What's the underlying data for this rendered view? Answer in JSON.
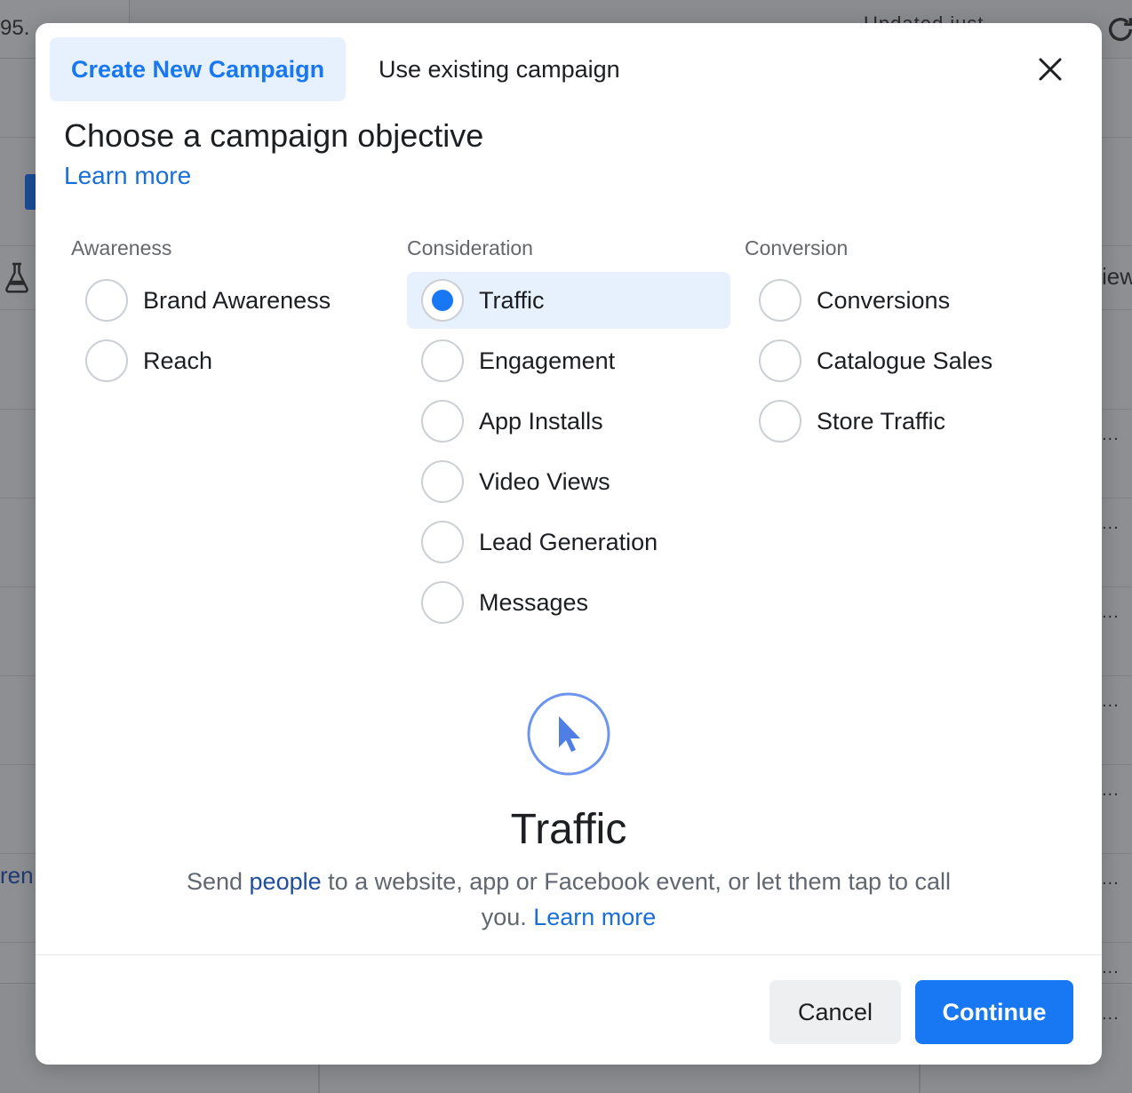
{
  "background": {
    "account_id_fragment": "95.",
    "updated_fragment": "Updated just",
    "view_fragment": "iew",
    "link_fragment": "ren",
    "row_dots": [
      "...",
      "...",
      "...",
      "...",
      "...",
      "...",
      "...",
      "..."
    ]
  },
  "modal": {
    "tabs": [
      {
        "label": "Create New Campaign",
        "active": true
      },
      {
        "label": "Use existing campaign",
        "active": false
      }
    ],
    "title": "Choose a campaign objective",
    "learn_more": "Learn more",
    "columns": [
      {
        "heading": "Awareness",
        "options": [
          "Brand Awareness",
          "Reach"
        ]
      },
      {
        "heading": "Consideration",
        "options": [
          "Traffic",
          "Engagement",
          "App Installs",
          "Video Views",
          "Lead Generation",
          "Messages"
        ]
      },
      {
        "heading": "Conversion",
        "options": [
          "Conversions",
          "Catalogue Sales",
          "Store Traffic"
        ]
      }
    ],
    "selected_option": "Traffic",
    "details": {
      "icon": "cursor-pointer-icon",
      "title": "Traffic",
      "desc_part1": "Send ",
      "desc_link1": "people",
      "desc_part2": " to a website, app or Facebook event, or let them tap to call you. ",
      "desc_link2": "Learn more"
    },
    "footer": {
      "cancel_label": "Cancel",
      "continue_label": "Continue"
    }
  },
  "colors": {
    "accent": "#1877f2",
    "selected_bg": "#e7f0fd",
    "overlay": "#8e8f92"
  }
}
